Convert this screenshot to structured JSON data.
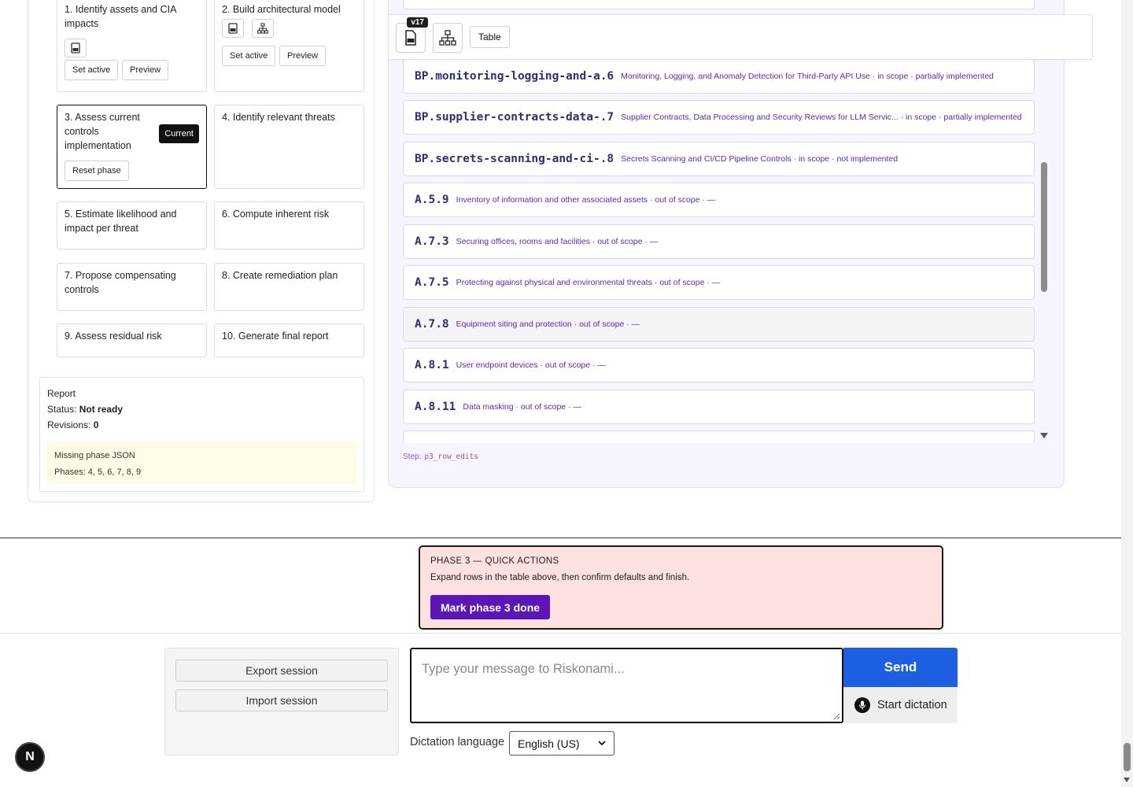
{
  "phases": [
    {
      "title": "1. Identify assets and CIA impacts",
      "buttons": [
        "Set active",
        "Preview"
      ]
    },
    {
      "title": "2. Build architectural model",
      "buttons": [
        "Set active",
        "Preview"
      ]
    },
    {
      "title": "3. Assess current controls implementation",
      "badge": "Current",
      "buttons": [
        "Reset phase"
      ]
    },
    {
      "title": "4. Identify relevant threats"
    },
    {
      "title": "5. Estimate likelihood and impact per threat"
    },
    {
      "title": "6. Compute inherent risk"
    },
    {
      "title": "7. Propose compensating controls"
    },
    {
      "title": "8. Create remediation plan"
    },
    {
      "title": "9. Assess residual risk"
    },
    {
      "title": "10. Generate final report"
    }
  ],
  "report": {
    "title": "Report",
    "status_label": "Status:",
    "status_value": "Not ready",
    "revisions_label": "Revisions:",
    "revisions_value": "0",
    "missing_title": "Missing phase JSON",
    "missing_phases": "Phases: 4, 5, 6, 7, 8, 9"
  },
  "toolbar": {
    "version_badge": "v17",
    "table_label": "Table"
  },
  "controls": [
    {
      "id": "BP.monitoring-logging-and-a.6",
      "desc": "Monitoring, Logging, and Anomaly Detection for Third-Party API Use · in scope · partially implemented"
    },
    {
      "id": "BP.supplier-contracts-data-.7",
      "desc": "Supplier Contracts, Data Processing and Security Reviews for LLM Servic... · in scope · partially implemented"
    },
    {
      "id": "BP.secrets-scanning-and-ci-.8",
      "desc": "Secrets Scanning and CI/CD Pipeline Controls · in scope · not implemented"
    },
    {
      "id": "A.5.9",
      "desc": "Inventory of information and other associated assets · out of scope · —"
    },
    {
      "id": "A.7.3",
      "desc": "Securing offices, rooms and facilities · out of scope · —"
    },
    {
      "id": "A.7.5",
      "desc": "Protecting against physical and environmental threats · out of scope · —"
    },
    {
      "id": "A.7.8",
      "desc": "Equipment siting and protection · out of scope · —"
    },
    {
      "id": "A.8.1",
      "desc": "User endpoint devices · out of scope · —"
    },
    {
      "id": "A.8.11",
      "desc": "Data masking · out of scope · —"
    }
  ],
  "step": {
    "label": "Step:",
    "value": "p3_row_edits"
  },
  "quick_actions": {
    "title": "PHASE 3 — QUICK ACTIONS",
    "description": "Expand rows in the table above, then confirm defaults and finish.",
    "button": "Mark phase 3 done"
  },
  "session": {
    "export": "Export session",
    "import": "Import session"
  },
  "chat": {
    "placeholder": "Type your message to Riskonami...",
    "send": "Send",
    "dictation": "Start dictation",
    "dictation_language_label": "Dictation language",
    "dictation_language_value": "English (US)"
  },
  "avatar_letter": "N",
  "colors": {
    "accent": "#5b16b8",
    "send": "#1c5fe0",
    "quick_bg": "#fde1e1",
    "control_id": "#2e2e70",
    "control_desc": "#5a2bb0"
  }
}
